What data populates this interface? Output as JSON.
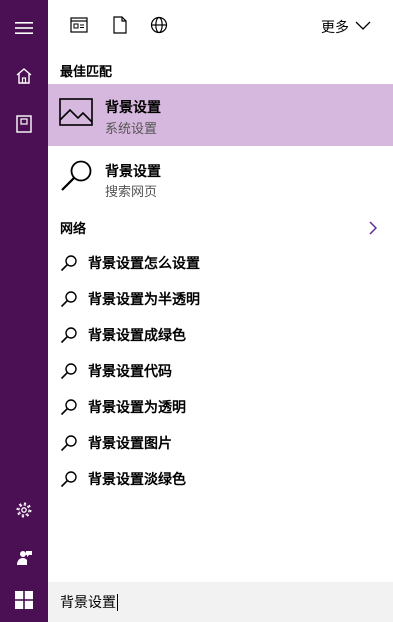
{
  "header": {
    "more_label": "更多"
  },
  "sections": {
    "best_match": "最佳匹配",
    "network": "网络"
  },
  "best_match": {
    "title": "背景设置",
    "subtitle": "系统设置"
  },
  "web_result": {
    "title": "背景设置",
    "subtitle": "搜索网页"
  },
  "suggestions": [
    "背景设置怎么设置",
    "背景设置为半透明",
    "背景设置成绿色",
    "背景设置代码",
    "背景设置为透明",
    "背景设置图片",
    "背景设置淡绿色"
  ],
  "search": {
    "value": "背景设置"
  },
  "colors": {
    "rail": "#4b0f53",
    "highlight": "#d6b7dd",
    "accent": "#5c2d91"
  },
  "icons": {
    "rail": [
      "hamburger-menu-icon",
      "home-icon",
      "notebook-icon",
      "gear-icon",
      "feedback-icon"
    ],
    "top": [
      "apps-filter-icon",
      "documents-filter-icon",
      "web-filter-icon"
    ],
    "start": "windows-logo-icon"
  }
}
